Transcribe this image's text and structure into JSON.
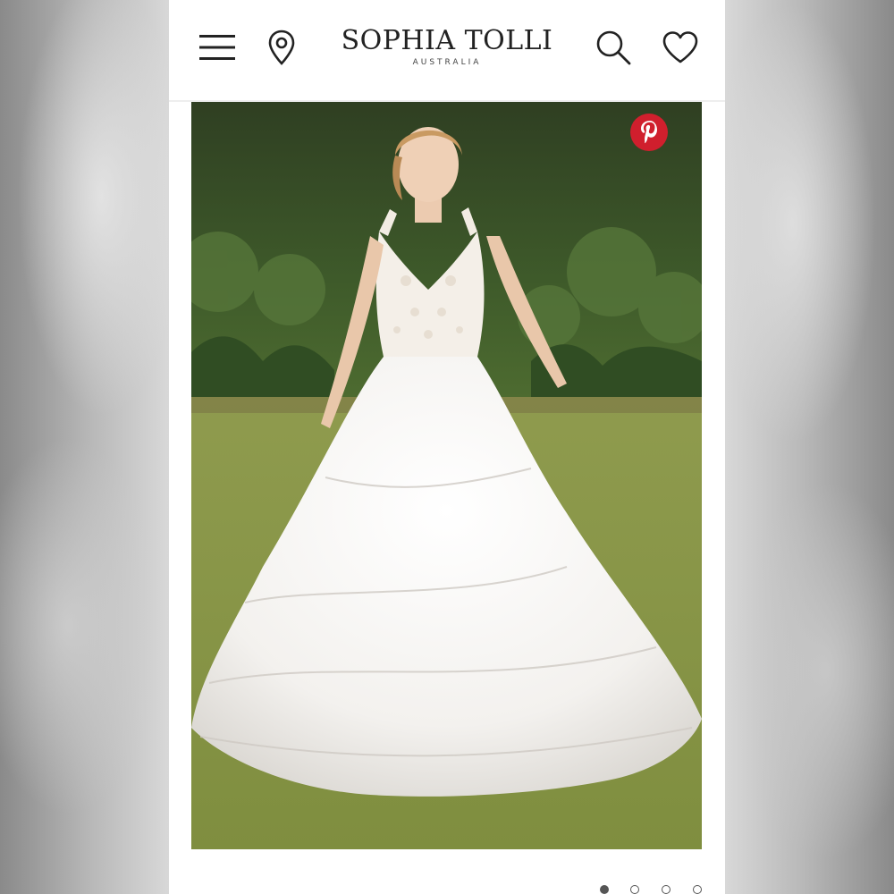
{
  "header": {
    "brand_name": "SOPHIA TOLLI",
    "brand_sub": "AUSTRALIA",
    "icons": {
      "menu": "hamburger-menu-icon",
      "location": "map-pin-icon",
      "search": "search-icon",
      "wishlist": "heart-icon"
    }
  },
  "gallery": {
    "image": "bride in white tiered tulle ball gown on lawn",
    "share_icon": "pinterest-icon",
    "slide_count": 4,
    "active_slide": 1
  },
  "colors": {
    "pinterest_red": "#d01f2d",
    "text_dark": "#222222",
    "dot_active": "#555555"
  }
}
